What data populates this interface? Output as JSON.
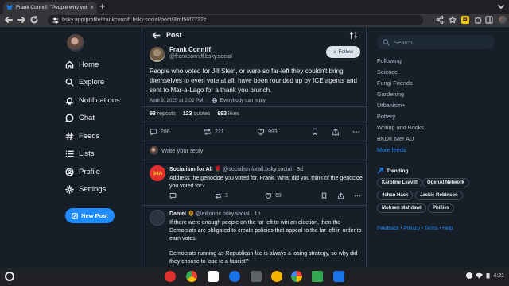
{
  "browser": {
    "tab_title": "Frank Conniff: \"People who vote",
    "tab_close": "×",
    "new_tab": "+",
    "url": "bsky.app/profile/frankconniff.bsky.social/post/3lmf56f2722z"
  },
  "sidebar": {
    "items": [
      {
        "label": "Home",
        "icon": "home-icon"
      },
      {
        "label": "Explore",
        "icon": "search-icon"
      },
      {
        "label": "Notifications",
        "icon": "bell-icon"
      },
      {
        "label": "Chat",
        "icon": "chat-icon"
      },
      {
        "label": "Feeds",
        "icon": "hash-icon"
      },
      {
        "label": "Lists",
        "icon": "list-icon"
      },
      {
        "label": "Profile",
        "icon": "profile-icon"
      },
      {
        "label": "Settings",
        "icon": "gear-icon"
      }
    ],
    "new_post": "New Post"
  },
  "header": {
    "title": "Post"
  },
  "post": {
    "author_name": "Frank Conniff",
    "author_handle": "@frankconniff.bsky.social",
    "follow_label": "Follow",
    "text": "People who voted for Jill Stein, or were so far-left they couldn't bring themselves to even vote at all, have been rounded up by ICE agents and sent to Mar-a-Lago for a thank you brunch.",
    "date": "April 9, 2025 at 2:02 PM",
    "separator": "·",
    "reply_setting": "Everybody can reply",
    "reposts": "98",
    "reposts_label": "reposts",
    "quotes": "123",
    "quotes_label": "quotes",
    "likes": "993",
    "likes_label": "likes",
    "reply_count": "286",
    "repost_count": "221",
    "like_count": "993"
  },
  "reply_prompt": "Write your reply",
  "replies": [
    {
      "name": "Socialism for All",
      "badge": "🌹",
      "handle": "@socialismforall.bsky.social",
      "time": "· 3d",
      "avatar_text": "S4A",
      "text": "Address the genocide you voted for, Frank. What did you think of the genocide you voted for?",
      "reposts": "3",
      "likes": "69"
    },
    {
      "name": "Daniel",
      "badge": "🌻",
      "handle": "@eikonos.bsky.social",
      "time": "· 1h",
      "text": "If there were enough people on the far left to win an election, then the Democrats are obligated to create policies that appeal to the far left in order to earn votes.",
      "text2": "Democrats running as Republican-lite is always a losing strategy, so why did they choose to lose to a fascist?"
    }
  ],
  "right": {
    "search_placeholder": "Search",
    "feeds": [
      "Following",
      "Science",
      "Fungi Friends",
      "Gardening",
      "Urbanism+",
      "Pottery",
      "Writing and Books",
      "BKDK Mer AU"
    ],
    "more_feeds": "More feeds",
    "trending_title": "Trending",
    "trending": [
      "Karoline Leavitt",
      "OpenAI Network",
      "4chan Hack",
      "Jackie Robinson",
      "Mohsen Mahdawi",
      "Phillies"
    ],
    "footer": "Feedback • Privacy • Terms • Help"
  },
  "shelf": {
    "time": "4:21"
  },
  "colors": {
    "accent": "#208bfe",
    "background": "#161e27",
    "border": "#2e4052"
  }
}
